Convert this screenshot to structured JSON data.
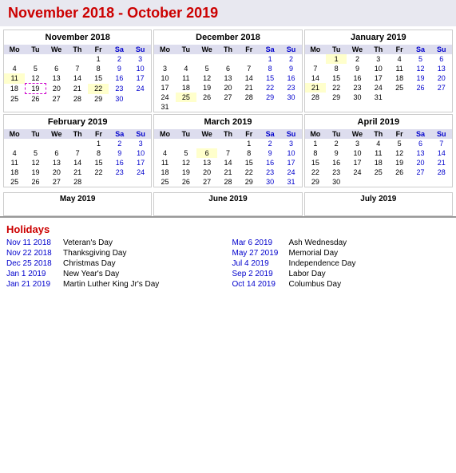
{
  "title": "November 2018 - October 2019",
  "calendars": [
    {
      "id": "nov2018",
      "title": "November 2018",
      "days_header": [
        "Mo",
        "Tu",
        "We",
        "Th",
        "Fr",
        "Sa",
        "Su"
      ],
      "weeks": [
        [
          "",
          "",
          "",
          "",
          "1",
          "2",
          "3"
        ],
        [
          "4",
          "5",
          "6",
          "7",
          "8",
          "9",
          "10"
        ],
        [
          "11",
          "12",
          "13",
          "14",
          "15",
          "16",
          "17"
        ],
        [
          "18",
          "19",
          "20",
          "21",
          "22",
          "23",
          "24"
        ],
        [
          "25",
          "26",
          "27",
          "28",
          "29",
          "30",
          ""
        ]
      ],
      "holidays": [
        "11",
        "22"
      ],
      "today": "19"
    },
    {
      "id": "dec2018",
      "title": "December 2018",
      "days_header": [
        "Mo",
        "Tu",
        "We",
        "Th",
        "Fr",
        "Sa",
        "Su"
      ],
      "weeks": [
        [
          "",
          "",
          "",
          "",
          "",
          "1",
          "2"
        ],
        [
          "3",
          "4",
          "5",
          "6",
          "7",
          "8",
          "9"
        ],
        [
          "10",
          "11",
          "12",
          "13",
          "14",
          "15",
          "16"
        ],
        [
          "17",
          "18",
          "19",
          "20",
          "21",
          "22",
          "23"
        ],
        [
          "24",
          "25",
          "26",
          "27",
          "28",
          "29",
          "30"
        ],
        [
          "31",
          "",
          "",
          "",
          "",
          "",
          ""
        ]
      ],
      "holidays": [
        "25"
      ],
      "today": ""
    },
    {
      "id": "jan2019",
      "title": "January 2019",
      "days_header": [
        "Mo",
        "Tu",
        "We",
        "Th",
        "Fr",
        "Sa",
        "Su"
      ],
      "weeks": [
        [
          "",
          "1",
          "2",
          "3",
          "4",
          "5",
          "6"
        ],
        [
          "7",
          "8",
          "9",
          "10",
          "11",
          "12",
          "13"
        ],
        [
          "14",
          "15",
          "16",
          "17",
          "18",
          "19",
          "20"
        ],
        [
          "21",
          "22",
          "23",
          "24",
          "25",
          "26",
          "27"
        ],
        [
          "28",
          "29",
          "30",
          "31",
          "",
          "",
          ""
        ]
      ],
      "holidays": [
        "1",
        "21"
      ],
      "today": ""
    },
    {
      "id": "feb2019",
      "title": "February 2019",
      "days_header": [
        "Mo",
        "Tu",
        "We",
        "Th",
        "Fr",
        "Sa",
        "Su"
      ],
      "weeks": [
        [
          "",
          "",
          "",
          "",
          "1",
          "2",
          "3"
        ],
        [
          "4",
          "5",
          "6",
          "7",
          "8",
          "9",
          "10"
        ],
        [
          "11",
          "12",
          "13",
          "14",
          "15",
          "16",
          "17"
        ],
        [
          "18",
          "19",
          "20",
          "21",
          "22",
          "23",
          "24"
        ],
        [
          "25",
          "26",
          "27",
          "28",
          "",
          "",
          ""
        ]
      ],
      "holidays": [],
      "today": ""
    },
    {
      "id": "mar2019",
      "title": "March 2019",
      "days_header": [
        "Mo",
        "Tu",
        "We",
        "Th",
        "Fr",
        "Sa",
        "Su"
      ],
      "weeks": [
        [
          "",
          "",
          "",
          "",
          "1",
          "2",
          "3"
        ],
        [
          "4",
          "5",
          "6",
          "7",
          "8",
          "9",
          "10"
        ],
        [
          "11",
          "12",
          "13",
          "14",
          "15",
          "16",
          "17"
        ],
        [
          "18",
          "19",
          "20",
          "21",
          "22",
          "23",
          "24"
        ],
        [
          "25",
          "26",
          "27",
          "28",
          "29",
          "30",
          "31"
        ]
      ],
      "holidays": [
        "6"
      ],
      "today": ""
    },
    {
      "id": "apr2019",
      "title": "April 2019",
      "days_header": [
        "Mo",
        "Tu",
        "We",
        "Th",
        "Fr",
        "Sa",
        "Su"
      ],
      "weeks": [
        [
          "1",
          "2",
          "3",
          "4",
          "5",
          "6",
          "7"
        ],
        [
          "8",
          "9",
          "10",
          "11",
          "12",
          "13",
          "14"
        ],
        [
          "15",
          "16",
          "17",
          "18",
          "19",
          "20",
          "21"
        ],
        [
          "22",
          "23",
          "24",
          "25",
          "26",
          "27",
          "28"
        ],
        [
          "29",
          "30",
          "",
          "",
          "",
          "",
          ""
        ]
      ],
      "holidays": [],
      "today": ""
    }
  ],
  "partial_months": [
    {
      "title": "May 2019"
    },
    {
      "title": "June 2019"
    },
    {
      "title": "July 2019"
    }
  ],
  "holidays_title": "Holidays",
  "holidays_left": [
    {
      "date": "Nov 11 2018",
      "name": "Veteran's Day"
    },
    {
      "date": "Nov 22 2018",
      "name": "Thanksgiving Day"
    },
    {
      "date": "Dec 25 2018",
      "name": "Christmas Day"
    },
    {
      "date": "Jan 1 2019",
      "name": "New Year's Day"
    },
    {
      "date": "Jan 21 2019",
      "name": "Martin Luther King Jr's Day"
    }
  ],
  "holidays_right": [
    {
      "date": "Mar 6 2019",
      "name": "Ash Wednesday"
    },
    {
      "date": "May 27 2019",
      "name": "Memorial Day"
    },
    {
      "date": "Jul 4 2019",
      "name": "Independence Day"
    },
    {
      "date": "Sep 2 2019",
      "name": "Labor Day"
    },
    {
      "date": "Oct 14 2019",
      "name": "Columbus Day"
    }
  ]
}
